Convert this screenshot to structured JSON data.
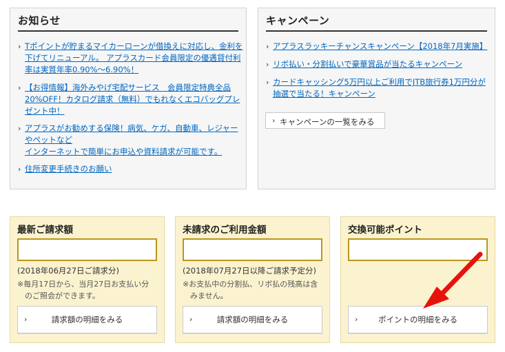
{
  "notice": {
    "title": "お知らせ",
    "items": [
      {
        "line1": "Tポイントが貯まるマイカーローンが借換えに対応し、金利を",
        "line2": "下げてリニューアル。 アプラスカード会員限定の優遇貸付利",
        "line3": "率は実質年率0.90%～6.90%！"
      },
      {
        "line1": "【お得情報】海外みやげ宅配サービス　会員限定特典全品",
        "line2": "20%OFF！カタログ請求（無料）でもれなくエコバッグプレ",
        "line3": "ゼント中！"
      },
      {
        "line1": "アプラスがお勧めする保険！病気、ケガ、自動車、レジャー",
        "line2": "やペットなど",
        "line3": "インターネットで簡単にお申込や資料請求が可能です。"
      },
      {
        "line1": "住所変更手続きのお願い"
      }
    ]
  },
  "campaign": {
    "title": "キャンペーン",
    "items": [
      {
        "line1": "アプラスラッキーチャンスキャンペーン【2018年7月実施】"
      },
      {
        "line1": "リボ払い・分割払いで豪華賞品が当たるキャンペーン"
      },
      {
        "line1": "カードキャッシング5万円以上ご利用でJTB旅行券1万円分が",
        "line2": "抽選で当たる！キャンペーン"
      }
    ],
    "list_button": "キャンペーンの一覧をみる"
  },
  "cards": {
    "latest": {
      "title": "最新ご請求額",
      "value": "",
      "date": "(2018年06月27日ご請求分)",
      "note1": "※毎月17日から、当月27日お支払い分",
      "note2": "のご照会ができます。",
      "button": "請求額の明細をみる"
    },
    "unbilled": {
      "title": "未請求のご利用金額",
      "value": "",
      "date": "(2018年07月27日以降ご請求予定分)",
      "note1": "※お支払中の分割払、リボ払の残高は含",
      "note2": "みません。",
      "button": "請求額の明細をみる"
    },
    "points": {
      "title": "交換可能ポイント",
      "value": "",
      "button": "ポイントの明細をみる"
    }
  },
  "icons": {
    "chevron": "›",
    "arrow_color": "#e8120c"
  }
}
